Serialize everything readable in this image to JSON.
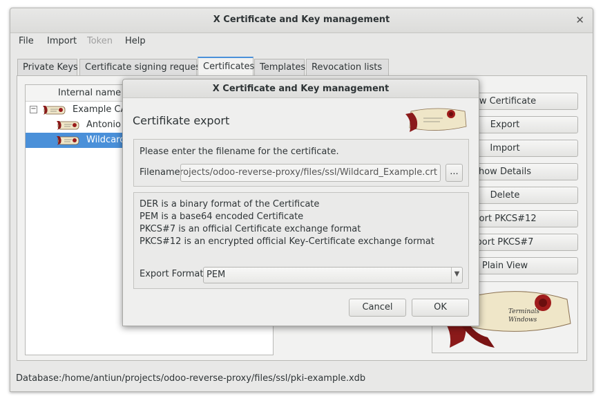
{
  "window": {
    "title": "X Certificate and Key management"
  },
  "menu": {
    "file": "File",
    "import": "Import",
    "token": "Token",
    "help": "Help"
  },
  "tabs": [
    {
      "label": "Private Keys"
    },
    {
      "label": "Certificate signing requests"
    },
    {
      "label": "Certificates"
    },
    {
      "label": "Templates"
    },
    {
      "label": "Revocation lists"
    }
  ],
  "tree": {
    "header": "Internal name",
    "rows": [
      {
        "label": "Example CA",
        "expander": "−"
      },
      {
        "label": "Antonio B"
      },
      {
        "label": "Wildcard"
      }
    ]
  },
  "side_buttons": {
    "new_certificate": "ew Certificate",
    "export": "Export",
    "import": "Import",
    "show_details": "how Details",
    "delete": "Delete",
    "import_pkcs12": "port PKCS#12",
    "import_pkcs7": "port PKCS#7",
    "plain_view": "Plain View"
  },
  "status": {
    "database": "Database:/home/antiun/projects/odoo-reverse-proxy/files/ssl/pki-example.xdb"
  },
  "dialog": {
    "title": "X Certificate and Key management",
    "heading": "Certifikate export",
    "instruction": "Please enter the filename for the certificate.",
    "filename_label": "Filename",
    "filename_value": "/home/antiun/projects/odoo-reverse-proxy/files/ssl/Wildcard_Example.crt",
    "browse_label": "...",
    "format_info": [
      "DER is a binary format of the Certificate",
      "PEM is a base64 encoded Certificate",
      "PKCS#7 is an official Certificate exchange format",
      "PKCS#12 is an encrypted official Key-Certificate exchange format"
    ],
    "format_label": "Export Format",
    "format_value": "PEM",
    "cancel_label": "Cancel",
    "ok_label": "OK"
  },
  "colors": {
    "accent": "#4a90d9",
    "scroll_red": "#8b1a1a",
    "parchment": "#efe6c8"
  }
}
